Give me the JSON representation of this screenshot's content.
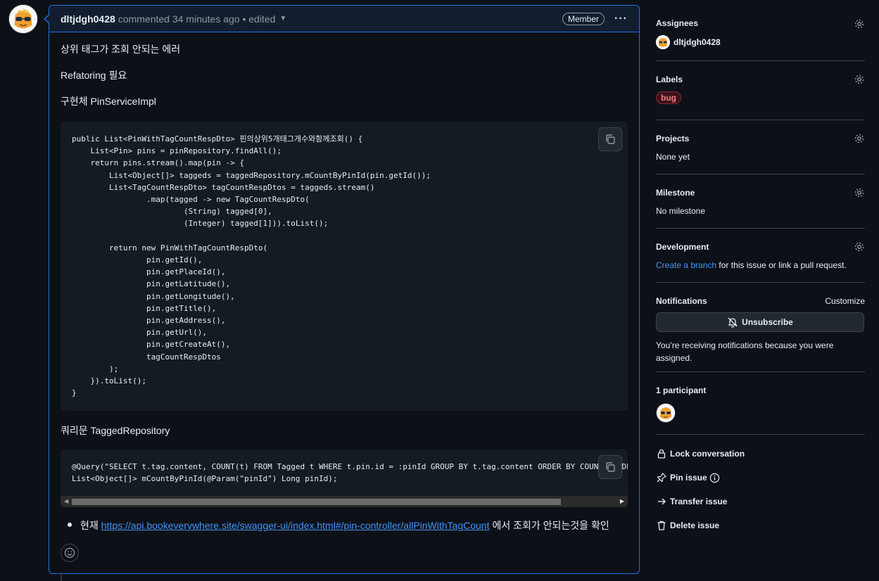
{
  "comment": {
    "author": "dltjdgh0428",
    "meta": "commented 34 minutes ago • edited",
    "role_badge": "Member",
    "more_label": "···",
    "paragraphs": [
      "상위 태그가 조회 안되는 에러",
      "Refatoring 필요",
      "구현체 PinServiceImpl"
    ],
    "code1": "public List<PinWithTagCountRespDto> 핀의상위5개태그개수와함께조회() {\n    List<Pin> pins = pinRepository.findAll();\n    return pins.stream().map(pin -> {\n        List<Object[]> taggeds = taggedRepository.mCountByPinId(pin.getId());\n        List<TagCountRespDto> tagCountRespDtos = taggeds.stream()\n                .map(tagged -> new TagCountRespDto(\n                        (String) tagged[0],\n                        (Integer) tagged[1])).toList();\n\n        return new PinWithTagCountRespDto(\n                pin.getId(),\n                pin.getPlaceId(),\n                pin.getLatitude(),\n                pin.getLongitude(),\n                pin.getTitle(),\n                pin.getAddress(),\n                pin.getUrl(),\n                pin.getCreateAt(),\n                tagCountRespDtos\n        );\n    }).toList();\n}",
    "query_heading": "쿼리문 TaggedRepository",
    "code2": "@Query(\"SELECT t.tag.content, COUNT(t) FROM Tagged t WHERE t.pin.id = :pinId GROUP BY t.tag.content ORDER BY COUNT(t) DES\nList<Object[]> mCountByPinId(@Param(\"pinId\") Long pinId);",
    "bullet_prefix": "현재",
    "bullet_link": "https://api.bookeverywhere.site/swagger-ui/index.html#/pin-controller/allPinWithTagCount",
    "bullet_suffix": "에서 조회가 안되는것을 확인"
  },
  "sidebar": {
    "assignees": {
      "title": "Assignees",
      "user": "dltjdgh0428"
    },
    "labels": {
      "title": "Labels",
      "label": "bug"
    },
    "projects": {
      "title": "Projects",
      "value": "None yet"
    },
    "milestone": {
      "title": "Milestone",
      "value": "No milestone"
    },
    "development": {
      "title": "Development",
      "link": "Create a branch",
      "text": "for this issue or link a pull request."
    },
    "notifications": {
      "title": "Notifications",
      "customize": "Customize",
      "button": "Unsubscribe",
      "reason": "You’re receiving notifications because you were assigned."
    },
    "participants": {
      "title": "1 participant"
    },
    "actions": {
      "lock": "Lock conversation",
      "pin": "Pin issue",
      "transfer": "Transfer issue",
      "delete": "Delete issue"
    }
  },
  "colors": {
    "accent": "#1f6feb",
    "link": "#4493f8",
    "bug_label": "#f47e86",
    "bg": "#0d1117"
  }
}
